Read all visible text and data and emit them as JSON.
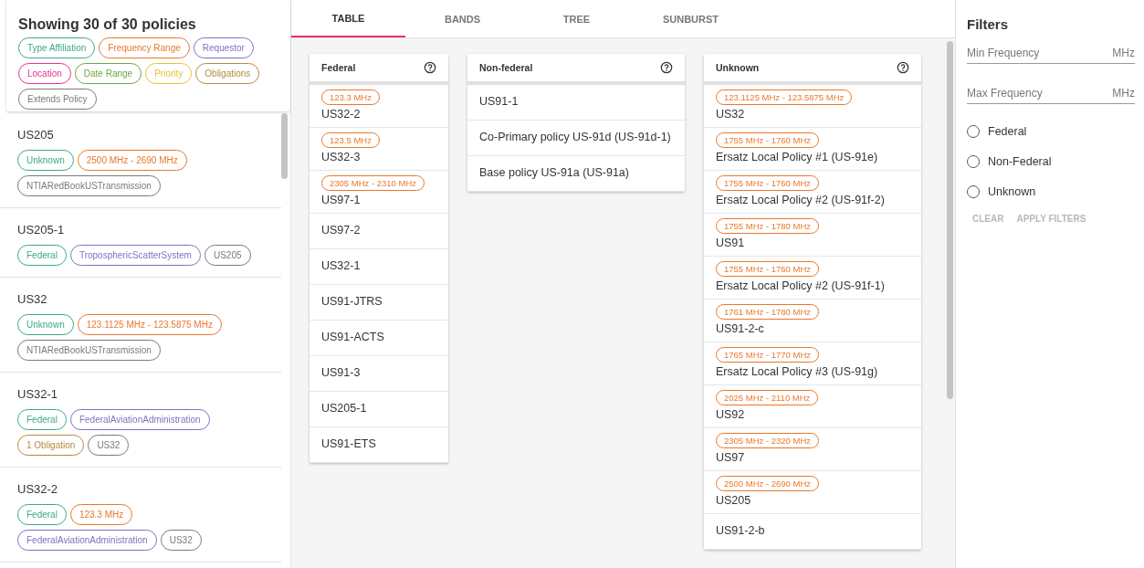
{
  "sidebar": {
    "heading": "Showing 30 of 30 policies",
    "legend": [
      {
        "label": "Type Affiliation",
        "color": "#3aa98a"
      },
      {
        "label": "Frequency Range",
        "color": "#e9782c"
      },
      {
        "label": "Requestor",
        "color": "#8071c4"
      },
      {
        "label": "Location",
        "color": "#e8308f"
      },
      {
        "label": "Date Range",
        "color": "#6aa83c"
      },
      {
        "label": "Priority",
        "color": "#eebd33"
      },
      {
        "label": "Obligations",
        "color": "#b58a3e"
      },
      {
        "label": "Extends Policy",
        "color": "#7a7a7a"
      }
    ],
    "policies": [
      {
        "name": "US205",
        "tags": [
          {
            "label": "Unknown",
            "color": "#3aa98a"
          },
          {
            "label": "2500 MHz - 2690 MHz",
            "color": "#e9782c"
          },
          {
            "label": "NTIARedBookUSTransmission",
            "color": "#7a7a7a"
          }
        ]
      },
      {
        "name": "US205-1",
        "tags": [
          {
            "label": "Federal",
            "color": "#3aa98a"
          },
          {
            "label": "TroposphericScatterSystem",
            "color": "#8071c4"
          },
          {
            "label": "US205",
            "color": "#7a7a7a"
          }
        ]
      },
      {
        "name": "US32",
        "tags": [
          {
            "label": "Unknown",
            "color": "#3aa98a"
          },
          {
            "label": "123.1125 MHz - 123.5875 MHz",
            "color": "#e9782c"
          },
          {
            "label": "NTIARedBookUSTransmission",
            "color": "#7a7a7a"
          }
        ]
      },
      {
        "name": "US32-1",
        "tags": [
          {
            "label": "Federal",
            "color": "#3aa98a"
          },
          {
            "label": "FederalAviationAdministration",
            "color": "#8071c4"
          },
          {
            "label": "1 Obligation",
            "color": "#b58a3e"
          },
          {
            "label": "US32",
            "color": "#7a7a7a"
          }
        ]
      },
      {
        "name": "US32-2",
        "tags": [
          {
            "label": "Federal",
            "color": "#3aa98a"
          },
          {
            "label": "123.3 MHz",
            "color": "#e9782c"
          },
          {
            "label": "FederalAviationAdministration",
            "color": "#8071c4"
          },
          {
            "label": "US32",
            "color": "#7a7a7a"
          }
        ]
      }
    ]
  },
  "tabs": [
    {
      "label": "TABLE",
      "selected": true
    },
    {
      "label": "BANDS",
      "selected": false
    },
    {
      "label": "TREE",
      "selected": false
    },
    {
      "label": "SUNBURST",
      "selected": false
    }
  ],
  "columns": [
    {
      "title": "Federal",
      "rows": [
        {
          "band": "123.3 MHz",
          "name": "US32-2"
        },
        {
          "band": "123.5 MHz",
          "name": "US32-3"
        },
        {
          "band": "2305 MHz - 2310 MHz",
          "name": "US97-1"
        },
        {
          "name": "US97-2"
        },
        {
          "name": "US32-1"
        },
        {
          "name": "US91-JTRS"
        },
        {
          "name": "US91-ACTS"
        },
        {
          "name": "US91-3"
        },
        {
          "name": "US205-1"
        },
        {
          "name": "US91-ETS"
        }
      ]
    },
    {
      "title": "Non-federal",
      "rows": [
        {
          "name": "US91-1"
        },
        {
          "name": "Co-Primary policy US-91d (US-91d-1)"
        },
        {
          "name": "Base policy US-91a (US-91a)"
        }
      ]
    },
    {
      "title": "Unknown",
      "rows": [
        {
          "band": "123.1125 MHz - 123.5875 MHz",
          "name": "US32"
        },
        {
          "band": "1755 MHz - 1760 MHz",
          "name": "Ersatz Local Policy #1 (US-91e)"
        },
        {
          "band": "1755 MHz - 1760 MHz",
          "name": "Ersatz Local Policy #2 (US-91f-2)"
        },
        {
          "band": "1755 MHz - 1780 MHz",
          "name": "US91"
        },
        {
          "band": "1755 MHz - 1760 MHz",
          "name": "Ersatz Local Policy #2 (US-91f-1)"
        },
        {
          "band": "1761 MHz - 1780 MHz",
          "name": "US91-2-c"
        },
        {
          "band": "1765 MHz - 1770 MHz",
          "name": "Ersatz Local Policy #3 (US-91g)"
        },
        {
          "band": "2025 MHz - 2110 MHz",
          "name": "US92"
        },
        {
          "band": "2305 MHz - 2320 MHz",
          "name": "US97"
        },
        {
          "band": "2500 MHz - 2690 MHz",
          "name": "US205"
        },
        {
          "name": "US91-2-b"
        }
      ]
    }
  ],
  "filters": {
    "title": "Filters",
    "fields": [
      {
        "placeholder": "Min Frequency",
        "unit": "MHz"
      },
      {
        "placeholder": "Max Frequency",
        "unit": "MHz"
      }
    ],
    "options": [
      {
        "label": "Federal",
        "selected": false
      },
      {
        "label": "Non-Federal",
        "selected": false
      },
      {
        "label": "Unknown",
        "selected": false
      }
    ],
    "buttons": [
      {
        "label": "CLEAR",
        "disabled": true
      },
      {
        "label": "APPLY FILTERS",
        "disabled": true
      }
    ]
  }
}
